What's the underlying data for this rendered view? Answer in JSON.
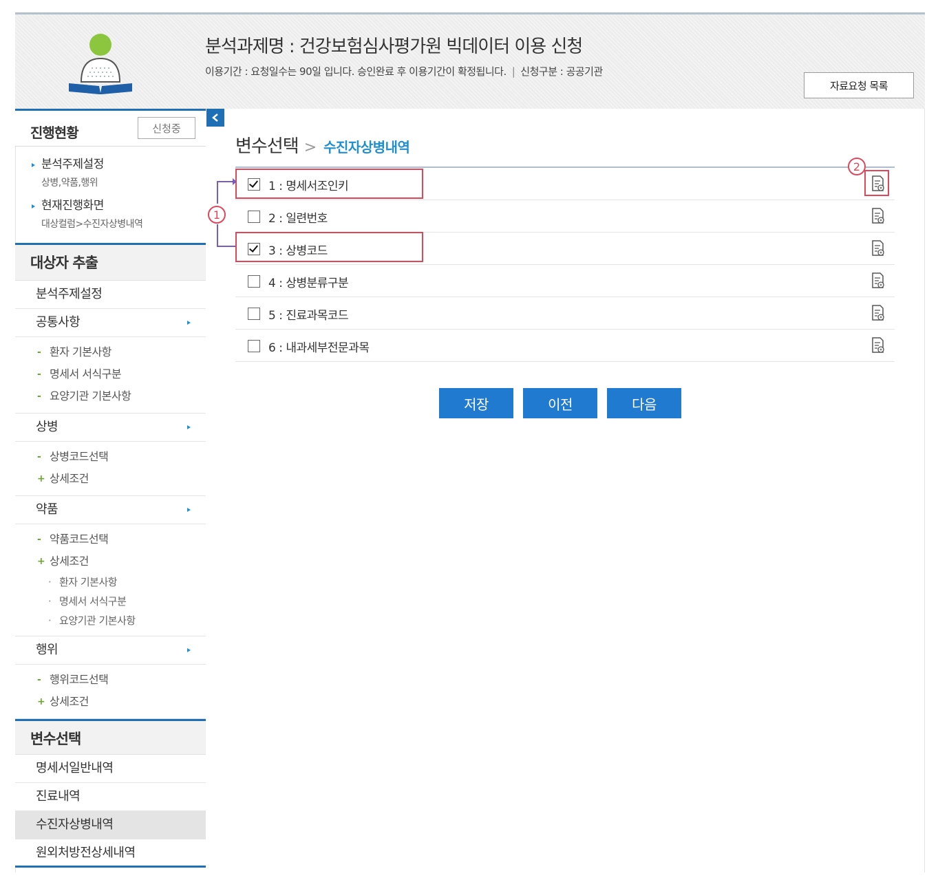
{
  "header": {
    "title": "분석과제명 : 건강보험심사평가원 빅데이터 이용 신청",
    "usage_period": "이용기간 : 요청일수는 90일 입니다. 승인완료 후 이용기간이 확정됩니다.",
    "separator": "|",
    "apply_type": "신청구분 : 공공기관",
    "request_list_button": "자료요청 목록"
  },
  "sidebar": {
    "status_label": "진행현황",
    "status_badge": "신청중",
    "progress": [
      {
        "head": "분석주제설정",
        "sub": "상병,약품,행위"
      },
      {
        "head": "현재진행화면",
        "sub": "대상컬럼>수진자상병내역"
      }
    ],
    "extract_title": "대상자 추출",
    "topic_setting": "분석주제설정",
    "common": {
      "label": "공통사항",
      "items": [
        "환자 기본사항",
        "명세서 서식구분",
        "요양기관 기본사항"
      ]
    },
    "disease": {
      "label": "상병",
      "items": [
        "상병코드선택",
        "상세조건"
      ]
    },
    "drug": {
      "label": "약품",
      "items": [
        "약품코드선택",
        "상세조건"
      ],
      "subitems": [
        "환자 기본사항",
        "명세서 서식구분",
        "요양기관 기본사항"
      ]
    },
    "action": {
      "label": "행위",
      "items": [
        "행위코드선택",
        "상세조건"
      ]
    },
    "vars_title": "변수선택",
    "vars_items": [
      "명세서일반내역",
      "진료내역",
      "수진자상병내역",
      "원외처방전상세내역"
    ],
    "markers": {
      "dash": "-",
      "plus": "+"
    }
  },
  "main": {
    "title": "변수선택",
    "crumb_sep": ">",
    "subtitle": "수진자상병내역",
    "variables": [
      {
        "label": "1 : 명세서조인키",
        "checked": true
      },
      {
        "label": "2 : 일련번호",
        "checked": false
      },
      {
        "label": "3 : 상병코드",
        "checked": true
      },
      {
        "label": "4 : 상병분류구분",
        "checked": false
      },
      {
        "label": "5 : 진료과목코드",
        "checked": false
      },
      {
        "label": "6 : 내과세부전문과목",
        "checked": false
      }
    ],
    "annotation_1": "1",
    "annotation_2": "2",
    "buttons": {
      "save": "저장",
      "prev": "이전",
      "next": "다음"
    }
  },
  "colors": {
    "accent": "#1f7ad0",
    "highlight": "#e0465a",
    "arrow": "#7a5bbf"
  }
}
